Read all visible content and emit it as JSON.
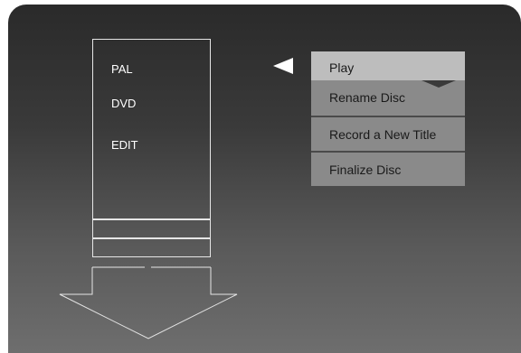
{
  "disc_info": {
    "system": "PAL",
    "media": "DVD",
    "mode": "EDIT"
  },
  "menu": {
    "items": [
      {
        "label": "Play",
        "selected": true
      },
      {
        "label": "Rename Disc",
        "selected": false
      },
      {
        "label": "Record a New Title",
        "selected": false
      },
      {
        "label": "Finalize Disc",
        "selected": false
      }
    ]
  },
  "colors": {
    "screen_top": "#2a2a2a",
    "screen_bottom": "#6e6e6e",
    "selected_item": "#bdbdbd",
    "menu_item": "#8a8a8a",
    "outline": "#e6e6e6"
  },
  "icons": {
    "pointer": "triangle-left-icon",
    "down": "down-arrow-icon"
  }
}
